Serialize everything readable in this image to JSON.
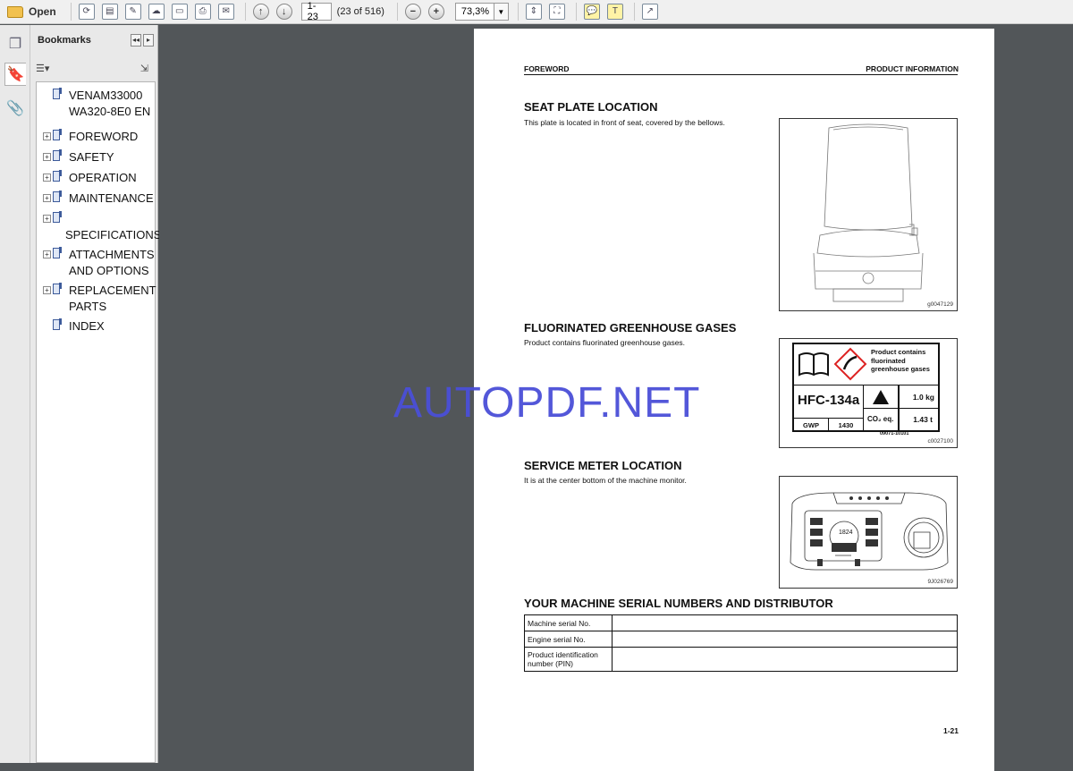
{
  "toolbar": {
    "open_label": "Open",
    "page_field": "1-23",
    "page_count": "(23 of 516)",
    "zoom_field": "73,3%",
    "icons": [
      "open-folder-icon",
      "create-pdf-icon",
      "combine-icon",
      "edit-icon",
      "cloud-icon",
      "save-icon",
      "print-icon",
      "email-icon",
      "prev-page-icon",
      "next-page-icon",
      "zoom-out-icon",
      "zoom-in-icon",
      "fit-width-icon",
      "fit-page-icon",
      "comment-icon",
      "highlight-icon",
      "fullscreen-icon"
    ]
  },
  "sidebar": {
    "title": "Bookmarks",
    "items": [
      {
        "label": "VENAM33000 WA320-8E0 EN",
        "expandable": false
      },
      {
        "label": "FOREWORD",
        "expandable": true
      },
      {
        "label": "SAFETY",
        "expandable": true
      },
      {
        "label": "OPERATION",
        "expandable": true
      },
      {
        "label": "MAINTENANCE",
        "expandable": true
      },
      {
        "label": "SPECIFICATIONS",
        "expandable": true
      },
      {
        "label": "ATTACHMENTS AND OPTIONS",
        "expandable": true
      },
      {
        "label": "REPLACEMENT PARTS",
        "expandable": true
      },
      {
        "label": "INDEX",
        "expandable": false
      }
    ]
  },
  "page": {
    "header_left": "FOREWORD",
    "header_right": "PRODUCT INFORMATION",
    "sections": [
      {
        "title": "SEAT PLATE LOCATION",
        "text": "This plate is located in front of seat, covered by the bellows.",
        "figure_id": "g0047129"
      },
      {
        "title": "FLUORINATED GREENHOUSE GASES",
        "text": "Product contains fluorinated greenhouse gases.",
        "figure_id": "c0027100"
      },
      {
        "title": "SERVICE METER LOCATION",
        "text": "It is at the center bottom of the machine monitor.",
        "figure_id": "9J026769"
      },
      {
        "title": "YOUR MACHINE SERIAL NUMBERS AND DISTRIBUTOR",
        "text": "",
        "figure_id": ""
      }
    ],
    "fgas_label": {
      "line1": "Product contains",
      "line2": "fluorinated",
      "line3": "greenhouse gases",
      "gas": "HFC-134a",
      "gwp_label": "GWP",
      "gwp_value": "1430",
      "weight": "1.0 kg",
      "co2_label": "CO₂ eq.",
      "co2_value": "1.43 t",
      "code": "09071-10101"
    },
    "meter_mark": "1824",
    "serial_rows": [
      {
        "label": "Machine serial No.",
        "value": ""
      },
      {
        "label": "Engine serial No.",
        "value": ""
      },
      {
        "label": "Product identification number (PIN)",
        "value": ""
      }
    ],
    "page_number": "1-21"
  },
  "watermark": "AUTOPDF.NET"
}
